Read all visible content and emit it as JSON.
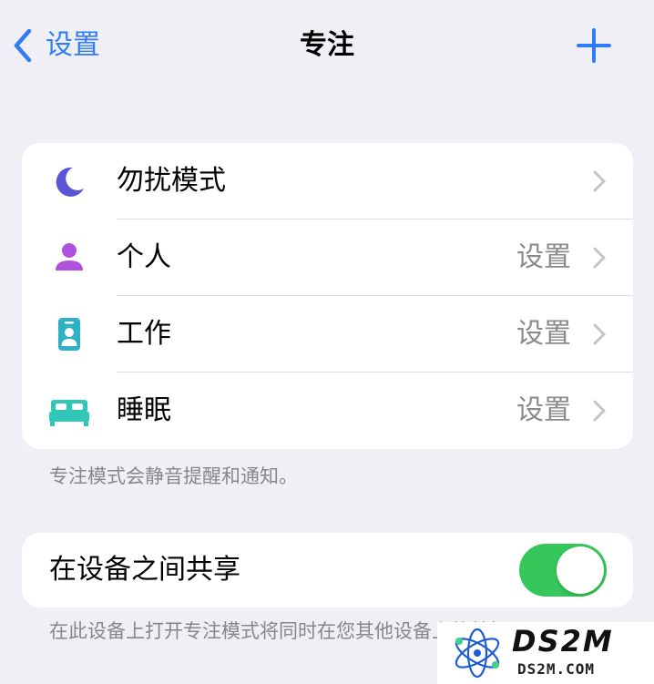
{
  "nav": {
    "back_label": "设置",
    "title": "专注",
    "back_icon": "chevron-left-icon",
    "add_icon": "plus-icon",
    "accent": "#2f7cf6"
  },
  "focus_modes": [
    {
      "label": "勿扰模式",
      "value": "",
      "icon": "moon-icon",
      "color": "#5856d6"
    },
    {
      "label": "个人",
      "value": "设置",
      "icon": "person-icon",
      "color": "#af52de"
    },
    {
      "label": "工作",
      "value": "设置",
      "icon": "badge-icon",
      "color": "#30b0c7"
    },
    {
      "label": "睡眠",
      "value": "设置",
      "icon": "bed-icon",
      "color": "#30c6b8"
    }
  ],
  "modes_footnote": "专注模式会静音提醒和通知。",
  "share": {
    "label": "在设备之间共享",
    "enabled": true,
    "toggle_color": "#35c759",
    "footnote": "在此设备上打开专注模式将同时在您其他设备上将其打开。"
  },
  "watermark": {
    "big": "DS2M",
    "small": "DS2M.COM"
  }
}
